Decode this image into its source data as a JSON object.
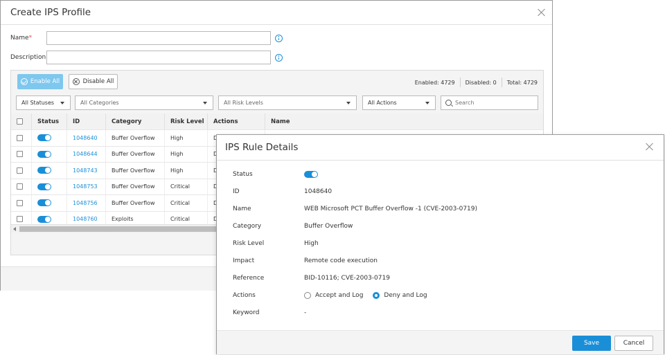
{
  "profile_dialog": {
    "title": "Create IPS Profile",
    "name_label": "Name",
    "name_required_mark": "*",
    "name_value": "",
    "description_label": "Description",
    "description_value": "",
    "enable_all_label": "Enable All",
    "disable_all_label": "Disable All",
    "counts": {
      "enabled": "Enabled: 4729",
      "disabled": "Disabled: 0",
      "total": "Total: 4729"
    },
    "filters": {
      "status": "All Statuses",
      "category": "All Categories",
      "risk": "All Risk Levels",
      "actions": "All Actions",
      "search_placeholder": "Search"
    },
    "columns": [
      "Status",
      "ID",
      "Category",
      "Risk Level",
      "Actions",
      "Name"
    ],
    "rows": [
      {
        "id": "1048640",
        "category": "Buffer Overflow",
        "risk": "High",
        "actions": "D",
        "enabled": true
      },
      {
        "id": "1048644",
        "category": "Buffer Overflow",
        "risk": "High",
        "actions": "D",
        "enabled": true
      },
      {
        "id": "1048743",
        "category": "Buffer Overflow",
        "risk": "High",
        "actions": "D",
        "enabled": true
      },
      {
        "id": "1048753",
        "category": "Buffer Overflow",
        "risk": "Critical",
        "actions": "D",
        "enabled": true
      },
      {
        "id": "1048756",
        "category": "Buffer Overflow",
        "risk": "Critical",
        "actions": "D",
        "enabled": true
      },
      {
        "id": "1048760",
        "category": "Exploits",
        "risk": "Critical",
        "actions": "D",
        "enabled": true
      }
    ]
  },
  "details_dialog": {
    "title": "IPS Rule Details",
    "fields": {
      "status_label": "Status",
      "status_enabled": true,
      "id_label": "ID",
      "id_value": "1048640",
      "name_label": "Name",
      "name_value": "WEB Microsoft PCT Buffer Overflow -1 (CVE-2003-0719)",
      "category_label": "Category",
      "category_value": "Buffer Overflow",
      "risk_label": "Risk Level",
      "risk_value": "High",
      "impact_label": "Impact",
      "impact_value": "Remote code execution",
      "reference_label": "Reference",
      "reference_value": "BID-10116; CVE-2003-0719",
      "actions_label": "Actions",
      "action_accept": "Accept and Log",
      "action_deny": "Deny and Log",
      "selected_action": "Deny and Log",
      "keyword_label": "Keyword",
      "keyword_value": "-"
    },
    "save_label": "Save",
    "cancel_label": "Cancel"
  },
  "colors": {
    "accent": "#1a8fd8",
    "enable_all_bg": "#7ec7ee",
    "border": "#b9b9b9"
  }
}
